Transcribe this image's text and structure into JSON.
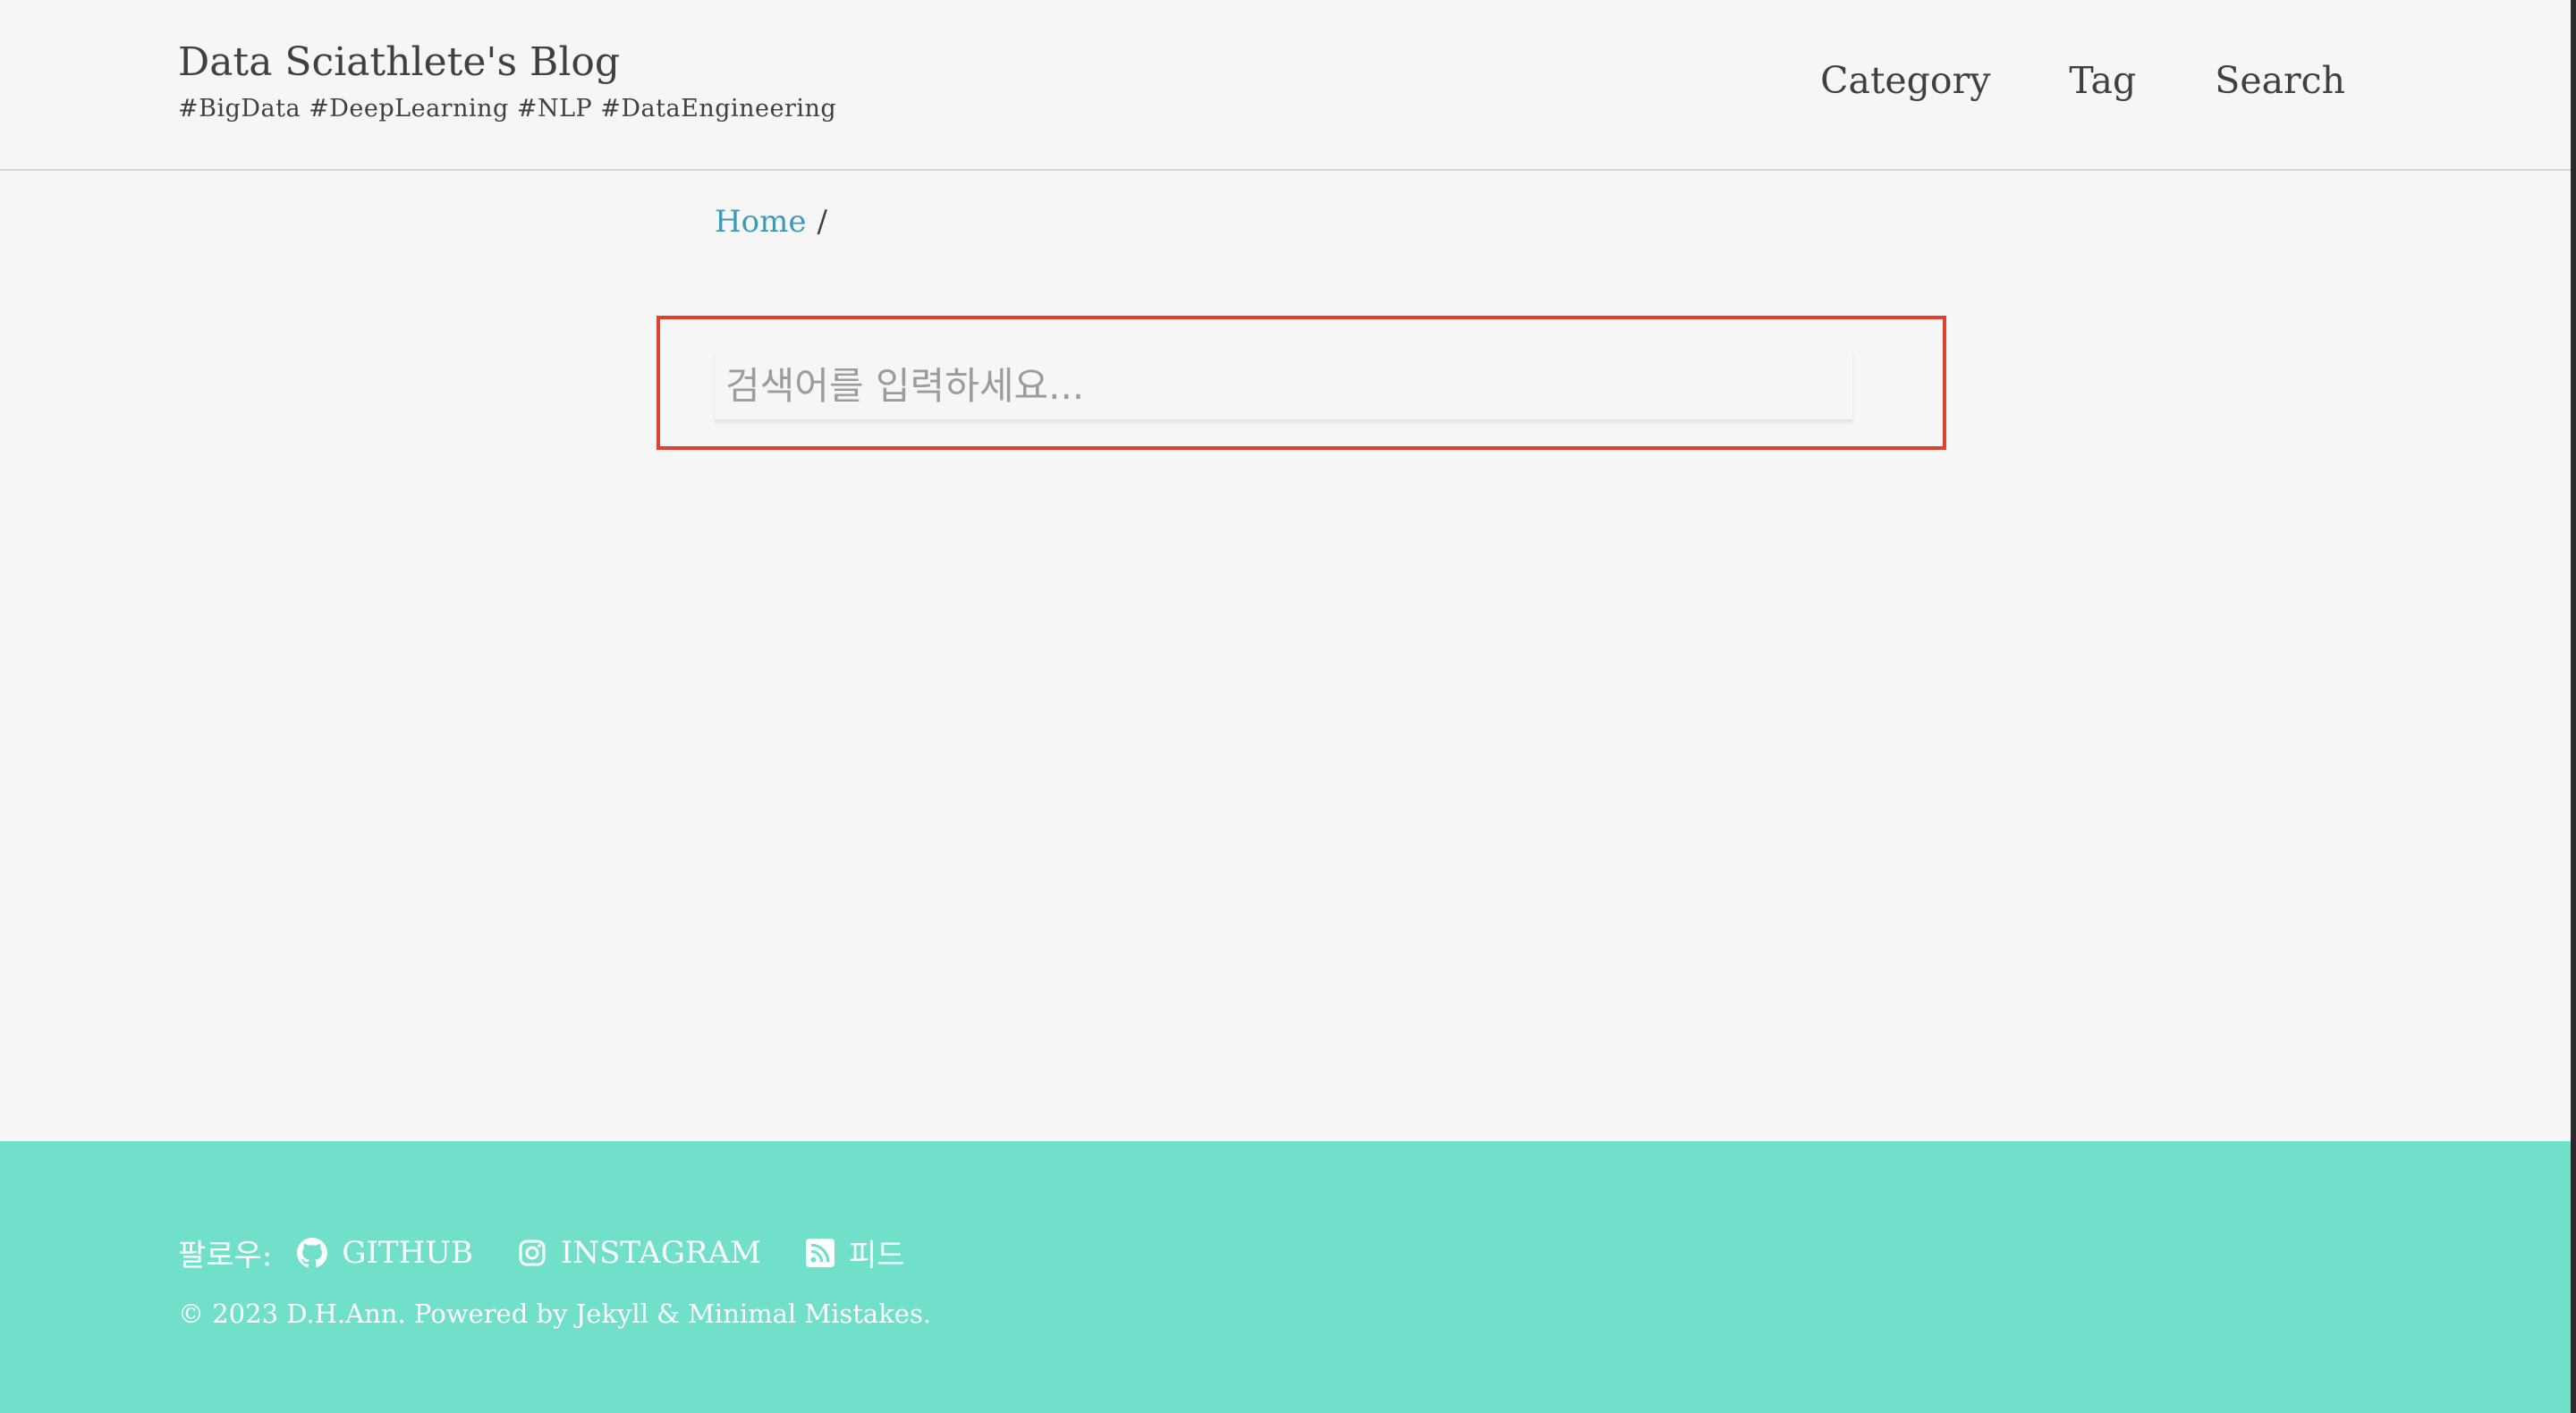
{
  "masthead": {
    "title": "Data Sciathlete's Blog",
    "subtitle": "#BigData #DeepLearning #NLP #DataEngineering",
    "nav": [
      {
        "label": "Category"
      },
      {
        "label": "Tag"
      },
      {
        "label": "Search"
      }
    ]
  },
  "breadcrumb": {
    "home": "Home",
    "separator": "/"
  },
  "search": {
    "placeholder": "검색어를 입력하세요...",
    "value": ""
  },
  "footer": {
    "follow_label": "팔로우:",
    "links": [
      {
        "label": "GITHUB",
        "icon": "github-icon"
      },
      {
        "label": "INSTAGRAM",
        "icon": "instagram-icon"
      },
      {
        "label": "피드",
        "icon": "rss-icon"
      }
    ],
    "copyright": "© 2023 D.H.Ann. Powered by Jekyll & Minimal Mistakes."
  },
  "colors": {
    "background": "#f5f6f5",
    "text": "#3d4144",
    "link": "#3b9cba",
    "footer_bg": "#71e0ca",
    "highlight_border": "#e0402c"
  }
}
